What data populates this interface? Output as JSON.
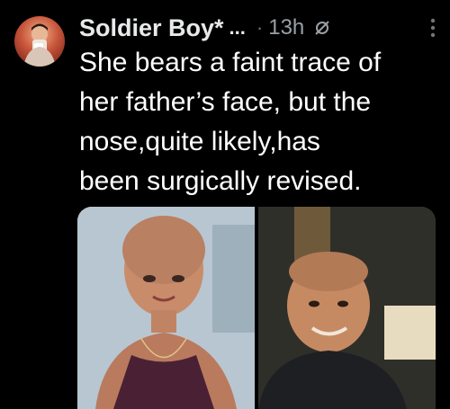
{
  "tweet": {
    "author_name": "Soldier Boy*",
    "name_truncation": "...",
    "separator": "·",
    "time_ago": "13h",
    "text": "She bears a faint trace of\nher father’s face, but the\nnose,quite likely,has\nbeen surgically revised."
  },
  "icons": {
    "visibility": "hidden-eye-slash-icon",
    "more": "more-vertical-icon"
  },
  "media": [
    {
      "description_label": ""
    },
    {
      "description_label": ""
    }
  ],
  "colors": {
    "background": "#000000",
    "text": "#e7e9ea",
    "secondary": "#71767b"
  }
}
